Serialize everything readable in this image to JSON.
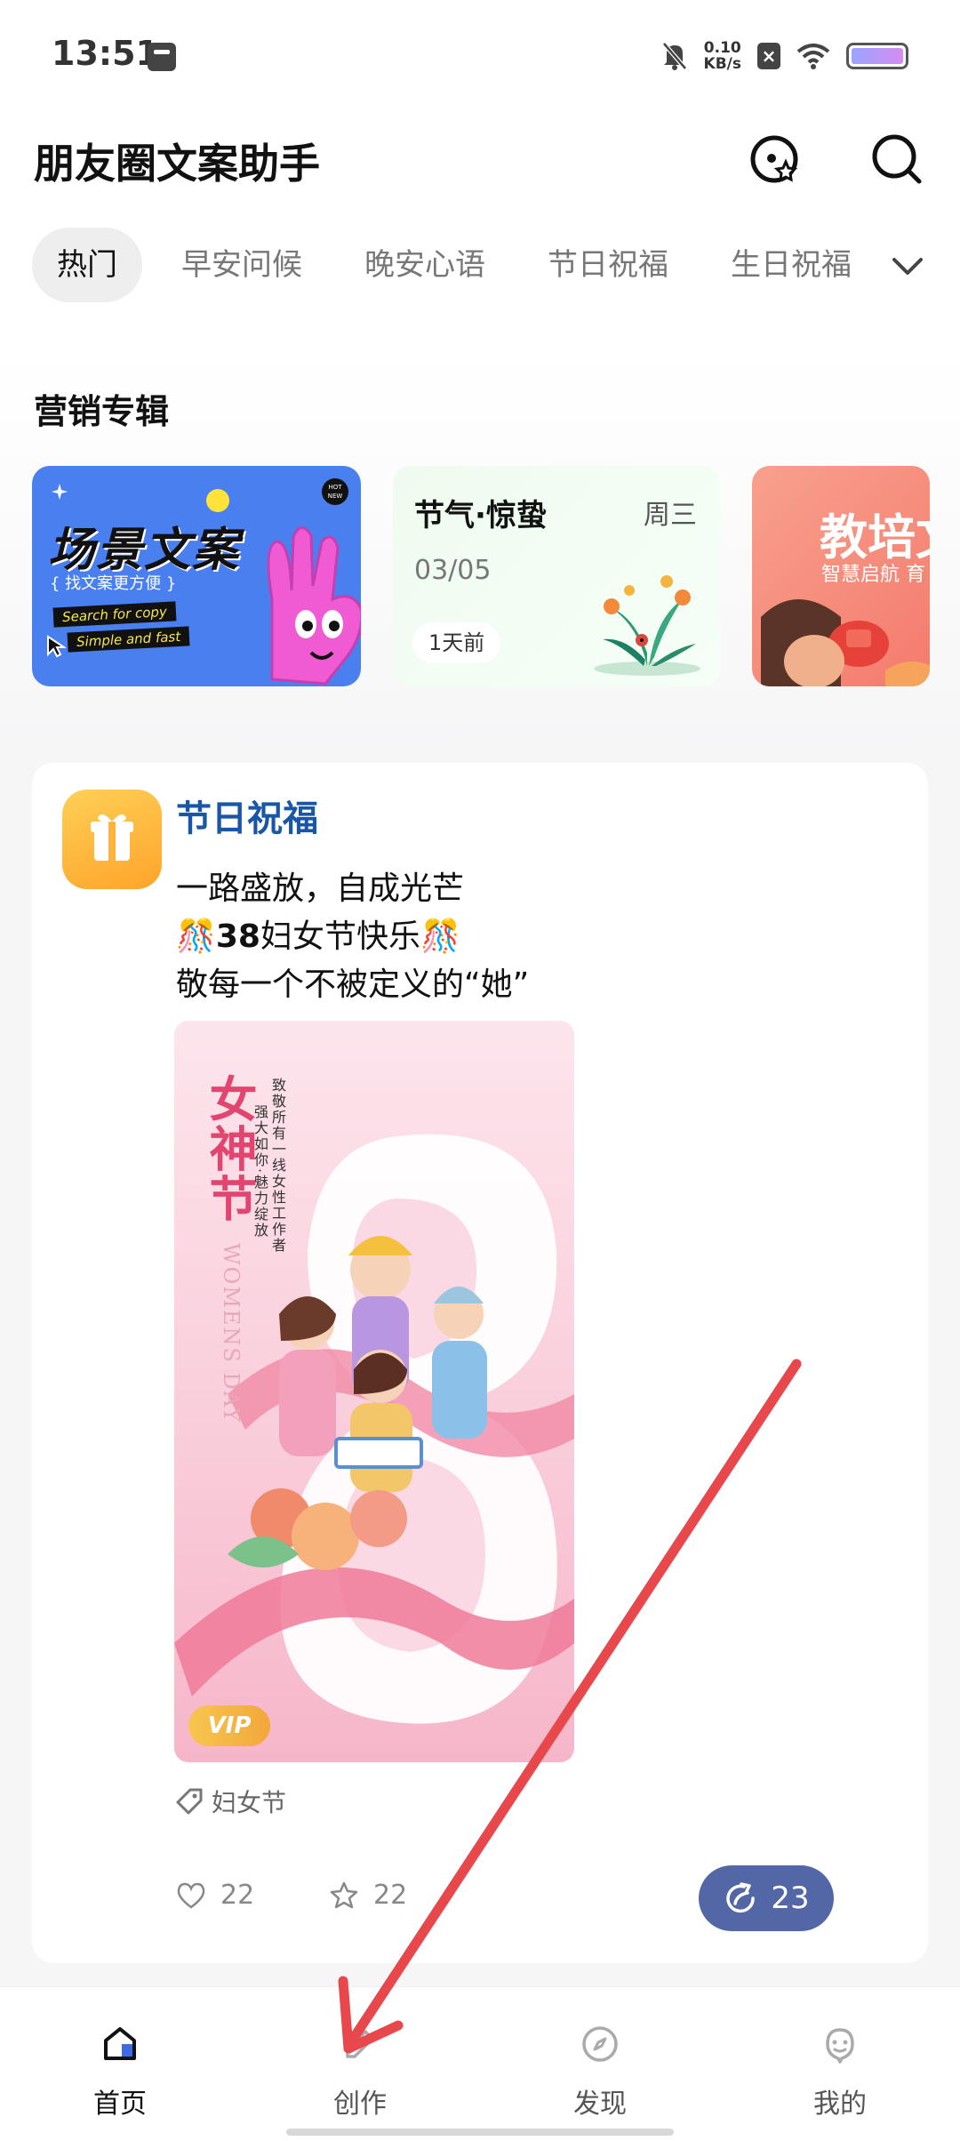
{
  "status_bar": {
    "time": "13:51",
    "net_speed_value": "0.10",
    "net_speed_unit": "KB/s",
    "icons": [
      "app-notification-icon",
      "mute-icon",
      "sim-disabled-icon",
      "wifi-icon",
      "battery-icon"
    ]
  },
  "header": {
    "title": "朋友圈文案助手",
    "icons": [
      "favorites-disc-icon",
      "search-icon"
    ]
  },
  "tabs": {
    "items": [
      "热门",
      "早安问候",
      "晚安心语",
      "节日祝福",
      "生日祝福"
    ],
    "active": "热门",
    "more_icon": "chevron-down-icon"
  },
  "marketing": {
    "title": "营销专辑",
    "cards": [
      {
        "title": "场景文案",
        "subtitle": "{ 找文案更方便 }",
        "tag1": "Search for copy",
        "tag2": "Simple and fast",
        "badge": "HOT NEW"
      },
      {
        "title": "节气·惊蛰",
        "weekday": "周三",
        "date": "03/05",
        "badge": "1天前"
      },
      {
        "title": "教培文",
        "subtitle": "智慧启航 育"
      }
    ]
  },
  "post": {
    "category": "节日祝福",
    "line1": "一路盛放，自成光芒",
    "line2_prefix": "🎊",
    "line2_bold": "38",
    "line2_text": "妇女节快乐🎊",
    "line3": "敬每一个不被定义的“她”",
    "poster": {
      "title": "女神节",
      "vtext1": "致敬所有一线女性工作者",
      "vtext2": "强大如你·魅力绽放",
      "en": "WOMENS DAY",
      "vip": "VIP"
    },
    "tag": "妇女节",
    "likes": "22",
    "favorites": "22",
    "shares": "23"
  },
  "bottom_nav": {
    "items": [
      {
        "label": "首页",
        "icon": "home-icon"
      },
      {
        "label": "创作",
        "icon": "pen-icon"
      },
      {
        "label": "发现",
        "icon": "compass-icon"
      },
      {
        "label": "我的",
        "icon": "profile-icon"
      }
    ],
    "active": "首页"
  },
  "colors": {
    "brand_blue": "#1a56a8",
    "share_button": "#5366a6",
    "annotation_arrow": "#e8474b"
  }
}
